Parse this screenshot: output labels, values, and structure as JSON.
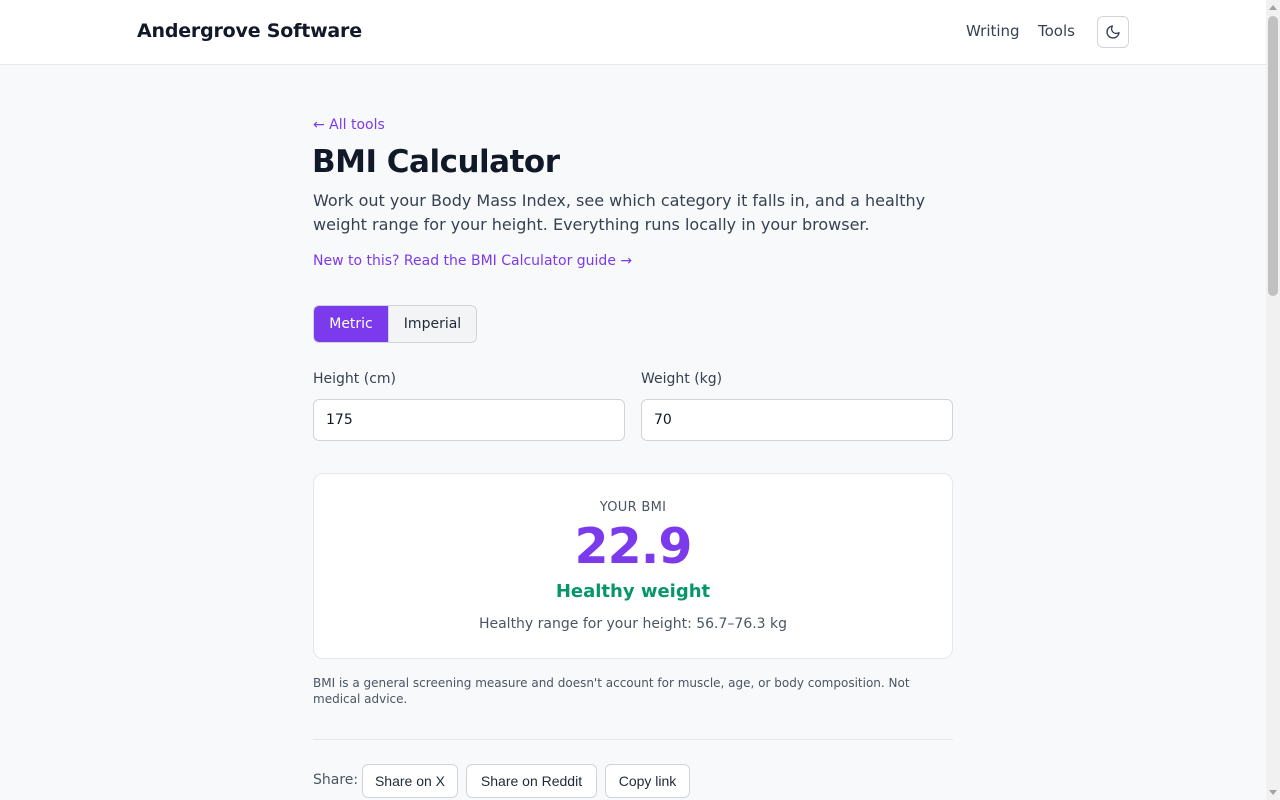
{
  "header": {
    "brand": "Andergrove Software",
    "nav": {
      "writing": "Writing",
      "tools": "Tools"
    },
    "theme_toggle_icon": "moon-icon"
  },
  "page": {
    "back_link": "← All tools",
    "title": "BMI Calculator",
    "description": "Work out your Body Mass Index, see which category it falls in, and a healthy weight range for your height. Everything runs locally in your browser.",
    "guide_link": "New to this? Read the BMI Calculator guide →"
  },
  "units": {
    "metric": "Metric",
    "imperial": "Imperial",
    "selected": "Metric"
  },
  "form": {
    "height_label": "Height (cm)",
    "height_value": "175",
    "weight_label": "Weight (kg)",
    "weight_value": "70"
  },
  "result": {
    "label": "YOUR BMI",
    "value": "22.9",
    "category": "Healthy weight",
    "range": "Healthy range for your height: 56.7–76.3 kg"
  },
  "disclaimer": "BMI is a general screening measure and doesn't account for muscle, age, or body composition. Not medical advice.",
  "share": {
    "label": "Share:",
    "x": "Share on X",
    "reddit": "Share on Reddit",
    "copy": "Copy link"
  },
  "colors": {
    "accent": "#7c3aed",
    "healthy": "#059669"
  }
}
